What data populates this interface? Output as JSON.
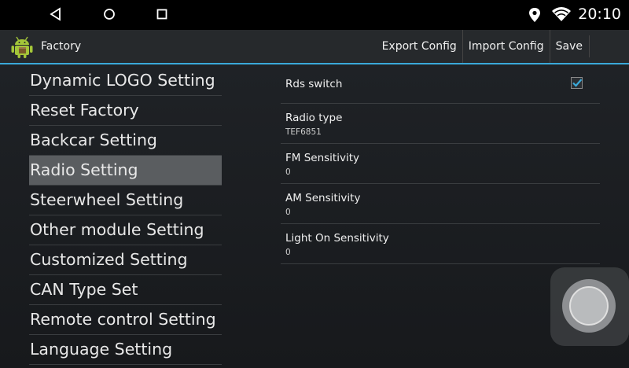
{
  "status_bar": {
    "time": "20:10",
    "icons": [
      "back-icon",
      "home-icon",
      "recents-icon",
      "location-icon",
      "wifi-icon"
    ]
  },
  "action_bar": {
    "title": "Factory",
    "app_icon": "android-icon",
    "actions": [
      "Export Config",
      "Import Config",
      "Save"
    ]
  },
  "menu": {
    "items": [
      "Dynamic LOGO Setting",
      "Reset Factory",
      "Backcar Setting",
      "Radio Setting",
      "Steerwheel Setting",
      "Other module Setting",
      "Customized Setting",
      "CAN Type Set",
      "Remote control Setting",
      "Language Setting"
    ],
    "selected": "Radio Setting"
  },
  "settings": {
    "rds": {
      "title": "Rds switch",
      "checked": true
    },
    "radio_type": {
      "title": "Radio type",
      "value": "TEF6851"
    },
    "fm": {
      "title": "FM Sensitivity",
      "value": "0"
    },
    "am": {
      "title": "AM Sensitivity",
      "value": "0"
    },
    "light": {
      "title": "Light On Sensitivity",
      "value": "0"
    }
  },
  "colors": {
    "accent": "#3aa9d9",
    "selected_bg": "#5a5d60",
    "background": "#1f2226"
  }
}
